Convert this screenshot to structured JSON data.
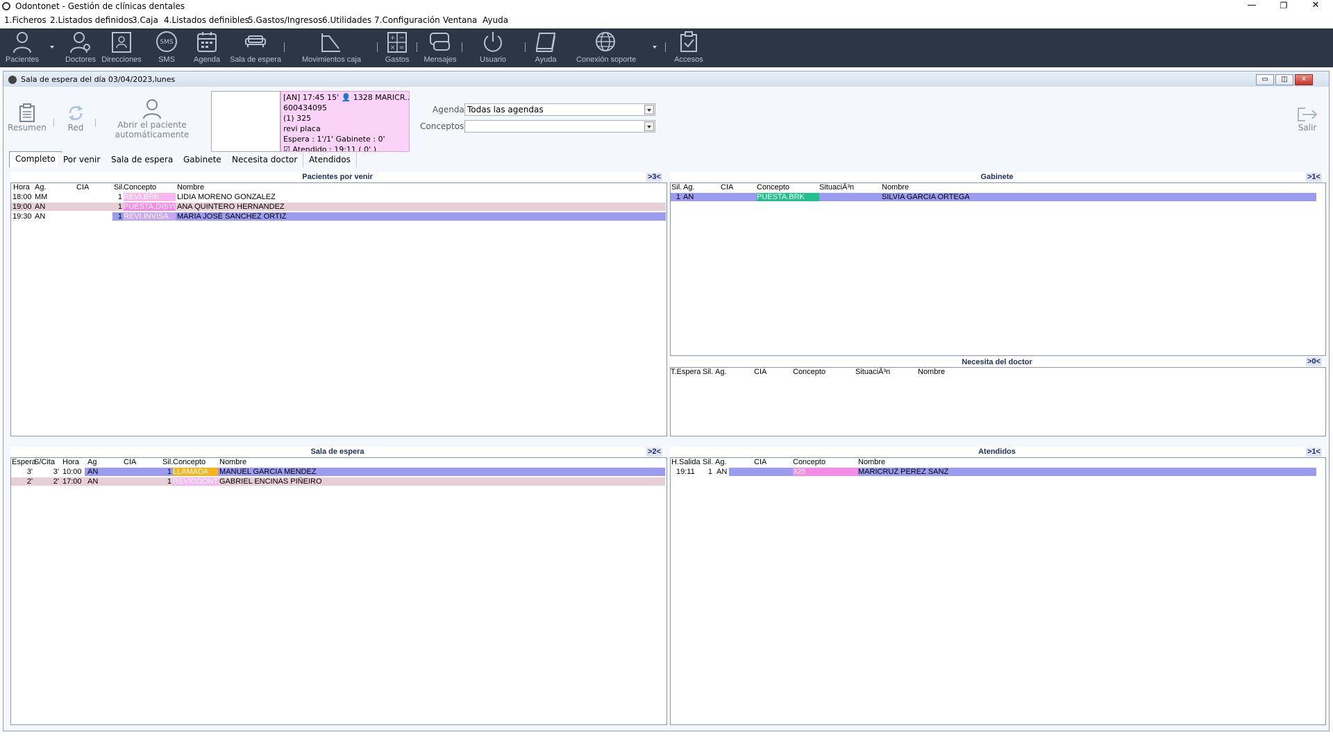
{
  "window": {
    "title": "Odontonet - Gestión de clínicas dentales",
    "minimize": "—",
    "restore": "❐",
    "close": "✕"
  },
  "menu": [
    {
      "label": "1.Ficheros"
    },
    {
      "label": "2.Listados definidos"
    },
    {
      "label": "3.Caja"
    },
    {
      "label": "4.Listados definibles"
    },
    {
      "label": "5.Gastos/Ingresos"
    },
    {
      "label": "6.Utilidades"
    },
    {
      "label": "7.Configuración"
    },
    {
      "label": "Ventana"
    },
    {
      "label": "Ayuda"
    }
  ],
  "toolbar": {
    "pacientes": "Pacientes",
    "doctores": "Doctores",
    "direcciones": "Direcciones",
    "sms": "SMS",
    "sms_icon_text": "SMS",
    "agenda": "Agenda",
    "sala": "Sala de espera",
    "movimientos": "Movimientos caja",
    "gastos": "Gastos",
    "mensajes": "Mensajes",
    "usuario": "Usuario",
    "ayuda": "Ayuda",
    "conexion": "Conexión soporte",
    "accesos": "Accesos"
  },
  "child": {
    "title": "Sala de espera del día 03/04/2023,lunes",
    "resumen": "Resumen",
    "red": "Red",
    "abrir_line1": "Abrir el paciente",
    "abrir_line2": "automáticamente",
    "salir": "Salir",
    "agenda_label": "Agenda",
    "agenda_value": "Todas las agendas",
    "conceptos_label": "Conceptos",
    "conceptos_value": ""
  },
  "patient_card": {
    "line1": "[AN] 17:45 15' 👤 1328 MARICR...",
    "line2": "600434095",
    "line3": "(1) 325",
    "line4": "revi placa",
    "line5": "Espera : 1'/1'  Gabinete : 0'",
    "line6": "☑ Atendido : 19:11 ( 0' )"
  },
  "tabs": [
    {
      "label": "Completo"
    },
    {
      "label": "Por venir"
    },
    {
      "label": "Sala de espera"
    },
    {
      "label": "Gabinete"
    },
    {
      "label": "Necesita doctor"
    },
    {
      "label": "Atendidos"
    }
  ],
  "por_venir": {
    "title": "Pacientes por venir",
    "count": ">3<",
    "columns": {
      "hora": "Hora",
      "ag": "Ag.",
      "cia": "CIA",
      "sil": "Sil.",
      "concepto": "Concepto",
      "nombre": "Nombre"
    },
    "rows": [
      {
        "hora": "18:00",
        "ag": "MM",
        "cia": "",
        "sil": "1",
        "concepto": "REVI.BRK",
        "nombre": "LIDIA MORENO GONZALEZ",
        "row_bg": "#ffffff",
        "concept_bg": "#f7b7f0"
      },
      {
        "hora": "19:00",
        "ag": "AN",
        "cia": "",
        "sil": "1",
        "concepto": "PUESTA.DISYU",
        "nombre": "ANA QUINTERO HERNANDEZ",
        "row_bg": "#e6cfd6",
        "concept_bg": "#f48ce6"
      },
      {
        "hora": "19:30",
        "ag": "AN",
        "cia": "",
        "sil": "1",
        "concepto": "REVI.INVISA",
        "nombre": "MARIA JOSÉ SANCHEZ ORTIZ",
        "row_bg": "#9b9bf0",
        "concept_bg": "#c7a6f2"
      }
    ]
  },
  "gabinete": {
    "title": "Gabinete",
    "count": ">1<",
    "columns": {
      "sil": "Sil.",
      "ag": "Ag.",
      "cia": "CIA",
      "concepto": "Concepto",
      "situacion": "SituaciÃ³n",
      "nombre": "Nombre"
    },
    "rows": [
      {
        "sil": "1",
        "ag": "AN",
        "cia": "",
        "concepto": "PUESTA.BRK",
        "situacion": "",
        "nombre": "SILVIA GARCIA ORTEGA",
        "row_bg": "#9b9bf0",
        "concept_bg": "#22c08a"
      }
    ]
  },
  "necesita": {
    "title": "Necesita del doctor",
    "count": ">0<",
    "columns": {
      "espera": "T.Espera",
      "sil": "Sil.",
      "ag": "Ag.",
      "cia": "CIA",
      "concepto": "Concepto",
      "situacion": "SituaciÃ³n",
      "nombre": "Nombre"
    }
  },
  "sala": {
    "title": "Sala de espera",
    "count": ">2<",
    "columns": {
      "espera": "Espera",
      "scita": "S/Cita",
      "hora": "Hora",
      "ag": "Ag",
      "cia": "CIA",
      "sil": "Sil.",
      "concepto": "Concepto",
      "nombre": "Nombre"
    },
    "rows": [
      {
        "espera": "3'",
        "scita": "3'",
        "hora": "10:00",
        "ag": "AN",
        "cia": "",
        "sil": "1",
        "concepto": "LLAMADA",
        "nombre": "MANUEL GARCIA MENDEZ",
        "row_bg": "#9b9bf0",
        "concept_bg": "#f6b51c"
      },
      {
        "espera": "2'",
        "scita": "2'",
        "hora": "17:00",
        "ag": "AN",
        "cia": "",
        "sil": "1",
        "concepto": "REVIODONT",
        "nombre": "GABRIEL ENCINAS PIÑEIRO",
        "row_bg": "#e6cfd6",
        "concept_bg": "#f7b7f0"
      }
    ]
  },
  "atendidos": {
    "title": "Atendidos",
    "count": ">1<",
    "columns": {
      "salida": "H.Salida",
      "sil": "Sil.",
      "ag": "Ag.",
      "cia": "CIA",
      "concepto": "Concepto",
      "nombre": "Nombre"
    },
    "rows": [
      {
        "salida": "19:11",
        "sil": "1",
        "ag": "AN",
        "cia": "",
        "concepto": "325",
        "nombre": "MARICRUZ PEREZ SANZ",
        "row_bg": "#9b9bf0",
        "concept_bg": "#f48ce6"
      }
    ]
  }
}
